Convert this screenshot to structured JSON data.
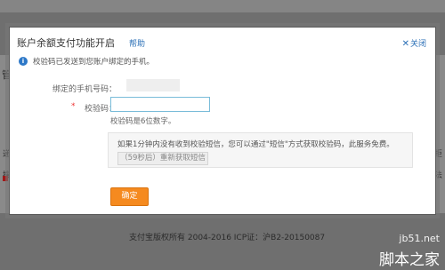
{
  "dialog": {
    "title": "账户余额支付功能开启",
    "help_label": "帮助",
    "close_label": "关闭",
    "close_icon": "close-icon"
  },
  "notice": {
    "icon": "info-icon",
    "text": "校验码已发送到您账户绑定的手机。"
  },
  "form": {
    "phone_label": "绑定的手机号码：",
    "code_label": "校验码：",
    "code_value": "",
    "code_hint": "校验码是6位数字。",
    "resend_text": "如果1分钟内没有收到校验短信，您可以通过\"短信\"方式获取校验码，此服务免费。",
    "resend_button": "（59秒后）重新获取短信",
    "confirm_button": "确定"
  },
  "background": {
    "left_texts": [
      "管",
      "递",
      "搜"
    ],
    "right_texts": [
      "拒",
      "法"
    ],
    "footer": "支付宝版权所有 2004-2016 ICP证：沪B2-20150087"
  },
  "watermark": {
    "url": "jb51.net",
    "name": "脚本之家"
  },
  "colors": {
    "accent": "#f58a1f",
    "link": "#2a6fb6",
    "input_border": "#79bcd9",
    "info": "#2d78c8"
  }
}
